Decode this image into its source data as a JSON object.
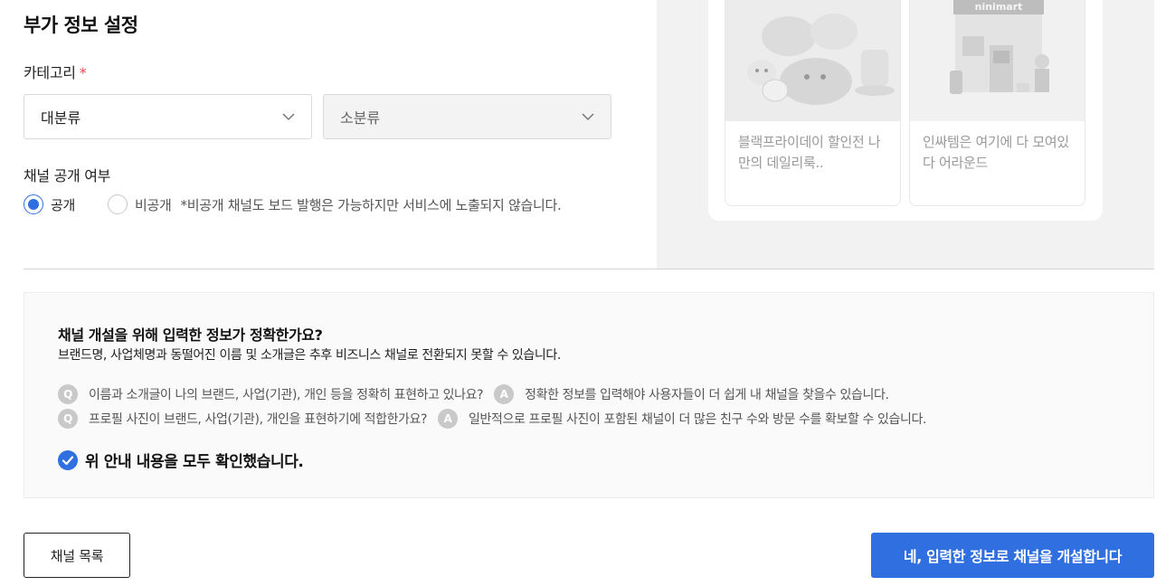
{
  "section": {
    "title": "부가 정보 설정"
  },
  "category": {
    "label": "카테고리",
    "required_mark": "*",
    "major_value": "대분류",
    "minor_value": "소분류"
  },
  "visibility": {
    "label": "채널 공개 여부",
    "options": [
      {
        "label": "공개",
        "selected": true
      },
      {
        "label": "비공개",
        "selected": false
      }
    ],
    "note": "*비공개 채널도 보드 발행은 가능하지만 서비스에 노출되지 않습니다."
  },
  "preview": {
    "boards": [
      {
        "text": "블랙프라이데이 할인전 나만의 데일리룩.."
      },
      {
        "text": "인싸템은 여기에 다 모여있다 어라운드",
        "thumb_label": "ninimart"
      }
    ]
  },
  "confirm": {
    "title": "채널 개설을 위해 입력한 정보가 정확한가요?",
    "subtitle": "브랜드명, 사업체명과 동떨어진 이름 및 소개글은 추후 비즈니스 채널로 전환되지 못할 수 있습니다.",
    "qa": [
      {
        "q_badge": "Q",
        "q": "이름과 소개글이 나의 브랜드, 사업(기관), 개인 등을 정확히 표현하고 있나요?",
        "a_badge": "A",
        "a": "정확한 정보를 입력해야 사용자들이 더 쉽게 내 채널을 찾을수 있습니다."
      },
      {
        "q_badge": "Q",
        "q": "프로필 사진이 브랜드, 사업(기관), 개인을 표현하기에 적합한가요?",
        "a_badge": "A",
        "a": "일반적으로 프로필 사진이 포함된 채널이 더 많은 친구 수와 방문 수를 확보할 수 있습니다."
      }
    ],
    "checkbox_label": "위 안내 내용을 모두 확인했습니다.",
    "checked": true
  },
  "actions": {
    "list_label": "채널 목록",
    "submit_label": "네, 입력한 정보로 채널을 개설합니다"
  },
  "colors": {
    "accent": "#2f6fe0",
    "required": "#e5484d"
  }
}
